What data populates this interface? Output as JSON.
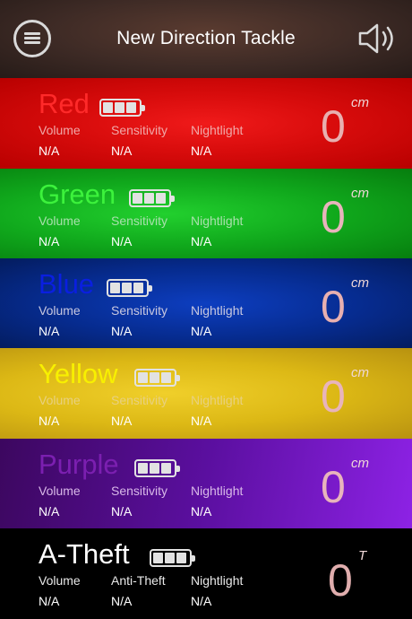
{
  "header": {
    "title": "New Direction Tackle",
    "menu_icon": "menu-icon",
    "speaker_icon": "speaker-icon"
  },
  "channels": [
    {
      "name": "Red",
      "name_color": "#ff2a2a",
      "label_color": "#f0a8a8",
      "battery_icon": "battery-icon",
      "labels": [
        "Volume",
        "Sensitivity",
        "Nightlight"
      ],
      "values": [
        "N/A",
        "N/A",
        "N/A"
      ],
      "reading": "0",
      "unit": "cm"
    },
    {
      "name": "Green",
      "name_color": "#3cf23c",
      "label_color": "#a8e0ac",
      "battery_icon": "battery-icon",
      "labels": [
        "Volume",
        "Sensitivity",
        "Nightlight"
      ],
      "values": [
        "N/A",
        "N/A",
        "N/A"
      ],
      "reading": "0",
      "unit": "cm"
    },
    {
      "name": "Blue",
      "name_color": "#0a1fe0",
      "label_color": "#c8c8e0",
      "battery_icon": "battery-icon",
      "labels": [
        "Volume",
        "Sensitivity",
        "Nightlight"
      ],
      "values": [
        "N/A",
        "N/A",
        "N/A"
      ],
      "reading": "0",
      "unit": "cm"
    },
    {
      "name": "Yellow",
      "name_color": "#f8f000",
      "label_color": "#e8d080",
      "battery_icon": "battery-icon",
      "labels": [
        "Volume",
        "Sensitivity",
        "Nightlight"
      ],
      "values": [
        "N/A",
        "N/A",
        "N/A"
      ],
      "reading": "0",
      "unit": "cm"
    },
    {
      "name": "Purple",
      "name_color": "#7b1fb0",
      "label_color": "#d8b8e8",
      "battery_icon": "battery-icon",
      "labels": [
        "Volume",
        "Sensitivity",
        "Nightlight"
      ],
      "values": [
        "N/A",
        "N/A",
        "N/A"
      ],
      "reading": "0",
      "unit": "cm"
    },
    {
      "name": "A-Theft",
      "name_color": "#ffffff",
      "label_color": "#e8e8e8",
      "battery_icon": "battery-icon",
      "labels": [
        "Volume",
        "Anti-Theft",
        "Nightlight"
      ],
      "values": [
        "N/A",
        "N/A",
        "N/A"
      ],
      "reading": "0",
      "unit": "T"
    }
  ]
}
